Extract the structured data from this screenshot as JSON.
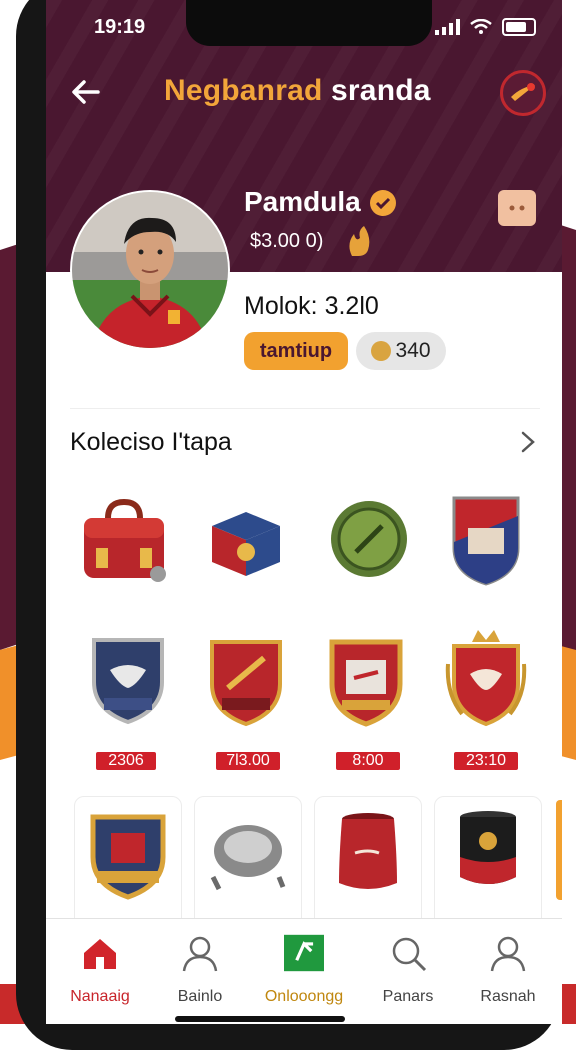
{
  "status": {
    "time": "19:19"
  },
  "header": {
    "title_part1": "Negbanrad",
    "title_part2": "sranda"
  },
  "profile": {
    "name": "Pamdula",
    "balance": "$3.00 0)",
    "level": "Molok: 3.2l0",
    "primary_button": "tamtiup",
    "coins": "340"
  },
  "section": {
    "title": "Kolecisо I'tapa"
  },
  "items": {
    "prices": [
      "2306",
      "7l3.00",
      "8:00",
      "23:10"
    ]
  },
  "tabs": [
    {
      "label": "Nanaaig"
    },
    {
      "label": "Bainlo"
    },
    {
      "label": "Onlooongg"
    },
    {
      "label": "Panars"
    },
    {
      "label": "Rasnah"
    }
  ],
  "colors": {
    "header": "#4a1730",
    "accent": "#f2a12f",
    "price": "#d0202a",
    "active_tab": "#c8252b"
  }
}
